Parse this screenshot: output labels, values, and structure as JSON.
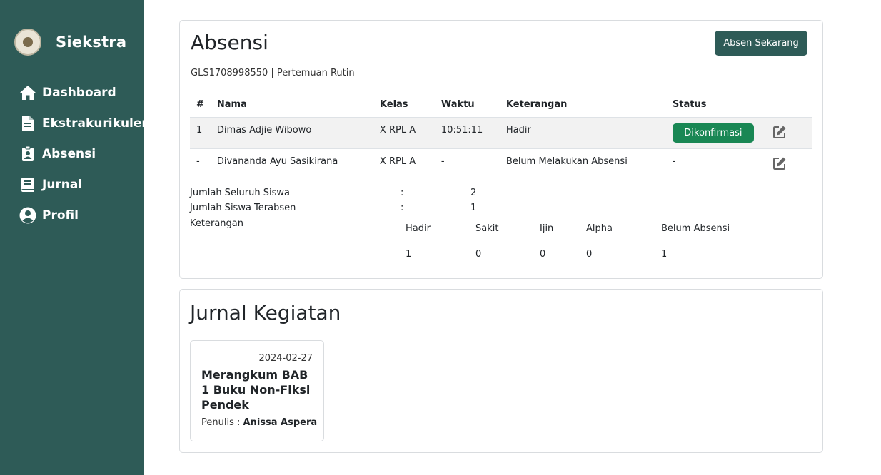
{
  "sidebar": {
    "brand": "Siekstra",
    "items": [
      {
        "label": "Dashboard",
        "icon": "home-icon"
      },
      {
        "label": "Ekstrakurikuler",
        "icon": "document-icon"
      },
      {
        "label": "Absensi",
        "icon": "clipboard-user-icon"
      },
      {
        "label": "Jurnal",
        "icon": "book-icon"
      },
      {
        "label": "Profil",
        "icon": "user-circle-icon"
      }
    ]
  },
  "absensi": {
    "title": "Absensi",
    "button_label": "Absen Sekarang",
    "subtitle": "GLS1708998550 | Pertemuan Rutin",
    "columns": [
      "#",
      "Nama",
      "Kelas",
      "Waktu",
      "Keterangan",
      "Status"
    ],
    "rows": [
      {
        "no": "1",
        "nama": "Dimas Adjie Wibowo",
        "kelas": "X RPL A",
        "waktu": "10:51:11",
        "keterangan": "Hadir",
        "status": "Dikonfirmasi"
      },
      {
        "no": "-",
        "nama": "Divananda Ayu Sasikirana",
        "kelas": "X RPL A",
        "waktu": "-",
        "keterangan": "Belum Melakukan Absensi",
        "status": "-"
      }
    ],
    "summary": {
      "total_label": "Jumlah Seluruh Siswa",
      "total_value": "2",
      "present_label": "Jumlah Siswa Terabsen",
      "present_value": "1",
      "colon": ":",
      "keterangan_label": "Keterangan",
      "breakdown_headers": [
        "Hadir",
        "Sakit",
        "Ijin",
        "Alpha",
        "Belum Absensi"
      ],
      "breakdown_values": [
        "1",
        "0",
        "0",
        "0",
        "1"
      ]
    }
  },
  "jurnal": {
    "title": "Jurnal Kegiatan",
    "cards": [
      {
        "date": "2024-02-27",
        "title": "Merangkum BAB 1 Buku Non-Fiksi Pendek",
        "author_prefix": "Penulis : ",
        "author": "Anissa Aspera"
      }
    ]
  },
  "colors": {
    "sidebar_bg": "#2e5b57",
    "primary_button": "#2e5b57",
    "success_badge": "#198754"
  }
}
